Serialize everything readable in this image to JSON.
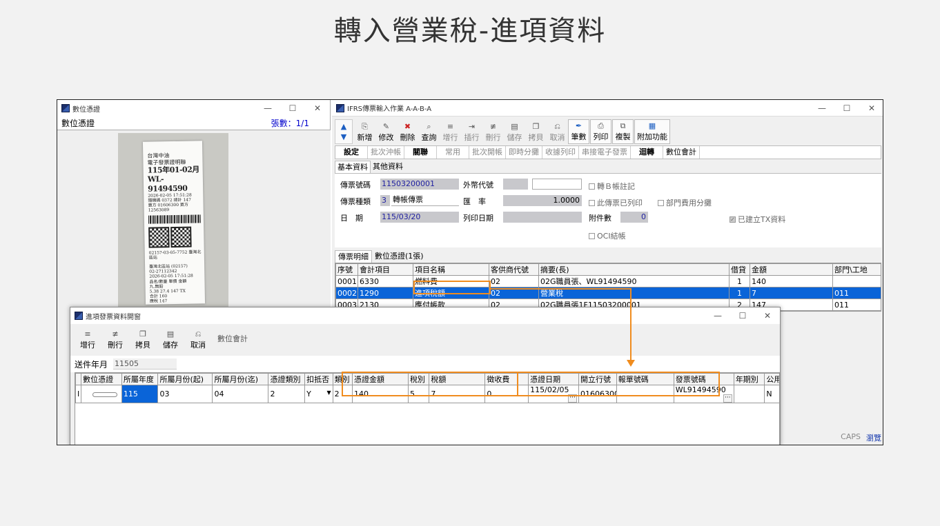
{
  "slide_title": "轉入營業稅-進項資料",
  "left_window": {
    "title": "數位憑證",
    "header_label": "數位憑證",
    "count_label": "張數：1/1",
    "receipt_lines": [
      "台灣中油",
      "電子發票證明聯",
      "115年01-02月",
      "WL-91494590",
      "2026-02-05 17:51:28",
      "隨機碼 0372  總計 147",
      "賣方 01606300 買方 12563089",
      "02157-03-05-7752 臺灣北區站",
      "臺灣北區站 (02157)",
      "02-27112342",
      "2026-02-05 17:51:28",
      "品名/數量  單價  金額",
      "九.無鉛",
      "5.38  27.4  147 TX",
      "合計 160",
      "應稅 147"
    ]
  },
  "right_window": {
    "title": "IFRS傳票輸入作業 A-A-B-A",
    "toolbar": [
      {
        "label": "新增",
        "icon": "new-doc-icon",
        "enabled": true
      },
      {
        "label": "修改",
        "icon": "edit-doc-icon",
        "enabled": true
      },
      {
        "label": "刪除",
        "icon": "delete-doc-icon",
        "enabled": true
      },
      {
        "label": "查詢",
        "icon": "query-doc-icon",
        "enabled": true
      },
      {
        "label": "增行",
        "icon": "add-row-icon",
        "enabled": false
      },
      {
        "label": "插行",
        "icon": "insert-row-icon",
        "enabled": false
      },
      {
        "label": "刪行",
        "icon": "delete-row-icon",
        "enabled": false
      },
      {
        "label": "儲存",
        "icon": "save-icon",
        "enabled": false
      },
      {
        "label": "拷貝",
        "icon": "copy-icon",
        "enabled": false
      },
      {
        "label": "取消",
        "icon": "cancel-icon",
        "enabled": false
      },
      {
        "label": "筆數",
        "icon": "pen-icon",
        "enabled": true
      },
      {
        "label": "列印",
        "icon": "print-icon",
        "enabled": true
      },
      {
        "label": "複製",
        "icon": "duplicate-icon",
        "enabled": true
      },
      {
        "label": "附加功能",
        "icon": "extra-icon",
        "enabled": true
      }
    ],
    "tab_row": [
      {
        "label": "設定",
        "state": "on"
      },
      {
        "label": "批次沖帳",
        "state": "dis"
      },
      {
        "label": "關聯",
        "state": "on"
      },
      {
        "label": "常用",
        "state": "dis"
      },
      {
        "label": "批次開帳",
        "state": "dis"
      },
      {
        "label": "即時分攤",
        "state": "dis"
      },
      {
        "label": "收據列印",
        "state": "dis"
      },
      {
        "label": "串接電子發票",
        "state": "dis"
      },
      {
        "label": "迴轉",
        "state": "on"
      },
      {
        "label": "數位會計",
        "state": "norm"
      }
    ],
    "sub_tabs": [
      "基本資料",
      "其他資料"
    ],
    "form": {
      "voucher_no_label": "傳票號碼",
      "voucher_no": "11503200001",
      "voucher_type_label": "傳票種類",
      "voucher_type_code": "3",
      "voucher_type_name": "轉帳傳票",
      "date_label": "日　期",
      "date": "115/03/20",
      "fx_code_label": "外幣代號",
      "rate_label": "匯　率",
      "rate": "1.0000",
      "print_date_label": "列印日期",
      "attach_label": "附件數",
      "attach": "0",
      "chk_transfer_b": "轉Ｂ帳註記",
      "chk_printed": "此傳票已列印",
      "chk_dept_share": "部門費用分攤",
      "chk_oci": "OCI結帳",
      "chk_tx_built": "已建立TX資料"
    },
    "detail_tabs": [
      "傳票明細",
      "數位憑證(1張)"
    ],
    "detail_headers": [
      "序號",
      "會計項目",
      "項目名稱",
      "客供商代號",
      "摘要(長)",
      "借貸",
      "金額",
      "部門\\工地"
    ],
    "detail_rows": [
      {
        "seq": "0001",
        "acct": "6330",
        "name": "燃料費",
        "vendor": "02",
        "memo": "02G職員張、WL91494590",
        "dc": "1",
        "amt": "140",
        "dept": ""
      },
      {
        "seq": "0002",
        "acct": "1290",
        "name": "進項稅額",
        "vendor": "02",
        "memo": "營業稅",
        "dc": "1",
        "amt": "7",
        "dept": "011"
      },
      {
        "seq": "0003",
        "acct": "2130",
        "name": "應付帳款",
        "vendor": "02",
        "memo": "02G職員張1F11503200001",
        "dc": "2",
        "amt": "147",
        "dept": "011"
      }
    ],
    "status_caps": "CAPS",
    "status_browse": "瀏覽"
  },
  "modal": {
    "title": "進項發票資料開窗",
    "toolbar": [
      {
        "label": "增行",
        "icon": "add-row-icon"
      },
      {
        "label": "刪行",
        "icon": "delete-row-icon"
      },
      {
        "label": "拷貝",
        "icon": "copy-icon"
      },
      {
        "label": "儲存",
        "icon": "save-icon"
      },
      {
        "label": "取消",
        "icon": "cancel-icon"
      }
    ],
    "digital_acct_label": "數位會計",
    "send_month_label": "送件年月",
    "send_month": "11505",
    "headers": [
      "數位憑證",
      "所屬年度",
      "所屬月份(起)",
      "所屬月份(迄)",
      "憑證類別",
      "扣抵否",
      "類別",
      "憑證金額",
      "稅別",
      "稅額",
      "徵收費",
      "憑證日期",
      "開立行號",
      "報單號碼",
      "發票號碼",
      "年期別",
      "公用事"
    ],
    "row": {
      "indicator": "I",
      "year": "115",
      "month_from": "03",
      "month_to": "04",
      "cert_type": "2",
      "deductible": "Y",
      "category": "2",
      "amount": "140",
      "tax_type": "5",
      "tax": "7",
      "fee": "0",
      "cert_date": "115/02/05",
      "issuer_no": "01606300",
      "decl_no": "",
      "invoice_no": "WL91494590",
      "period": "",
      "utility": "N"
    }
  },
  "highlight_color": "#f08c1e"
}
